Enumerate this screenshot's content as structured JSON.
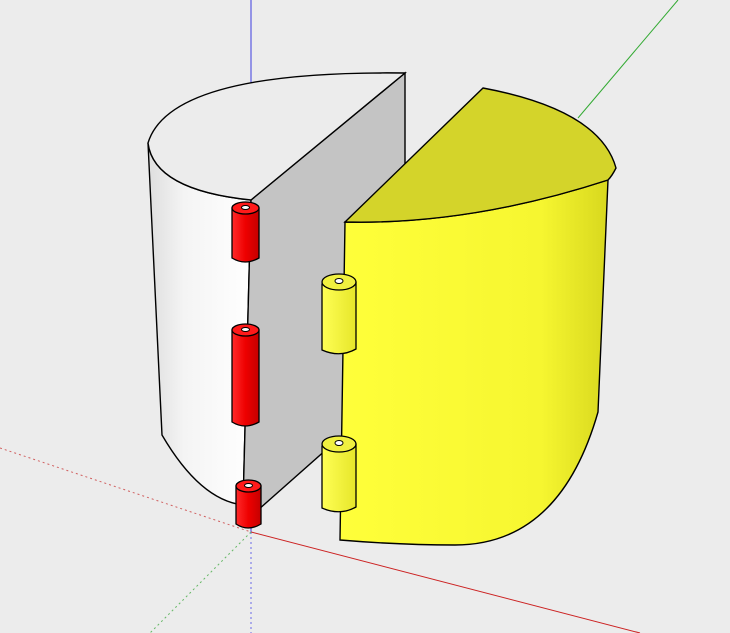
{
  "scene": {
    "background_color": "#ececec",
    "axes": {
      "blue_axis_color": "#3b3be0",
      "red_axis_color": "#cc2222",
      "green_axis_color": "#33aa33"
    },
    "objects": [
      {
        "name": "white-half-cylinder",
        "color": "#f2f2f2",
        "cut_face_color": "#c4c4c4"
      },
      {
        "name": "yellow-half-cylinder",
        "color": "#ffff33",
        "top_color": "#d4d42a"
      },
      {
        "name": "red-hinge-knuckles",
        "count": 3,
        "color": "#ee0000"
      },
      {
        "name": "yellow-hinge-knuckles",
        "count": 2,
        "color": "#ffff44"
      }
    ]
  }
}
